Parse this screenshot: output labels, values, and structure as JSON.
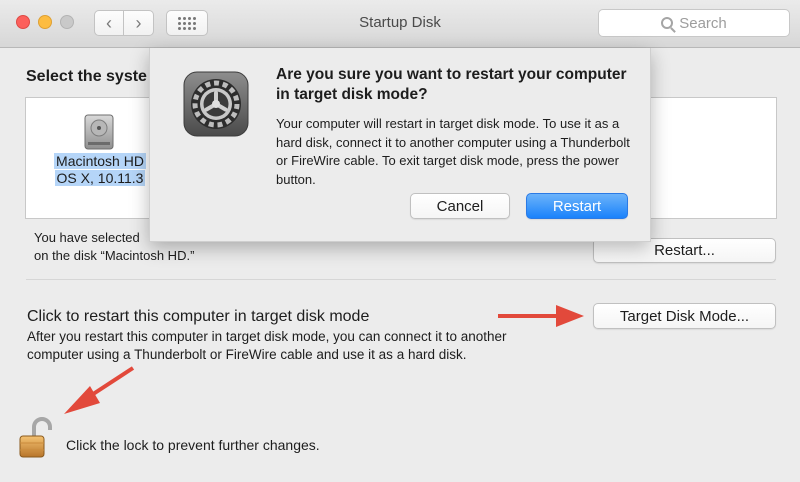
{
  "window": {
    "title": "Startup Disk",
    "search_placeholder": "Search",
    "back_glyph": "‹",
    "forward_glyph": "›"
  },
  "main": {
    "select_heading": "Select the syste",
    "disk": {
      "name": "Macintosh HD",
      "os": "OS X, 10.11.3",
      "icon": "hard-disk-icon"
    },
    "selected_line1": "You have selected",
    "selected_line2": "on the disk “Macintosh HD.”",
    "restart_button": "Restart...",
    "tdm_heading": "Click to restart this computer in target disk mode",
    "tdm_description": "After you restart this computer in target disk mode, you can connect it to another computer using a Thunderbolt or FireWire cable and use it as a hard disk.",
    "tdm_button": "Target Disk Mode...",
    "lock_text": "Click the lock to prevent further changes."
  },
  "dialog": {
    "title": "Are you sure you want to restart your computer in target disk mode?",
    "message": "Your computer will restart in target disk mode. To use it as a hard disk, connect it to another computer using a Thunderbolt or FireWire cable. To exit target disk mode, press the power button.",
    "cancel_label": "Cancel",
    "confirm_label": "Restart",
    "icon": "system-preferences-gear-icon"
  },
  "colors": {
    "accent": "#1a82fb",
    "annotation_arrow": "#e2493b",
    "selection": "#b5d5f8"
  }
}
